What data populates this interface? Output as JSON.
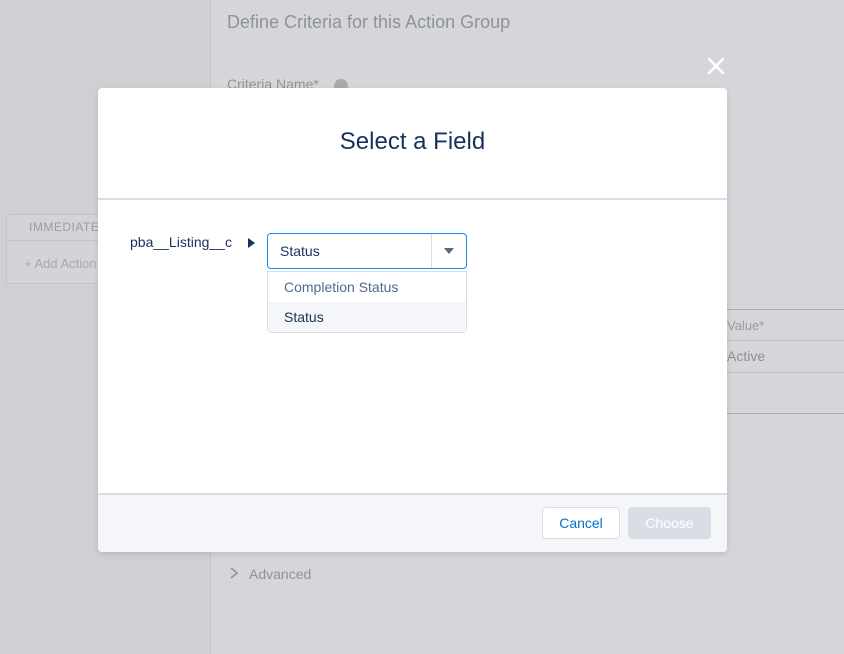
{
  "background": {
    "page_title": "Define Criteria for this Action Group",
    "criteria_name_label": "Criteria Name",
    "criteria_name_required_mark": "*",
    "immediate_label": "IMMEDIATE",
    "add_action_label": "+ Add Action",
    "value_header": "Value",
    "value_required_mark": "*",
    "value_cell": "Active",
    "advanced_label": "Advanced"
  },
  "modal": {
    "title": "Select a Field",
    "close_icon": "close-icon",
    "object_label": "pba__Listing__c",
    "field_select": {
      "value": "Status",
      "options": [
        "Completion Status",
        "Status"
      ],
      "selected": "Status"
    },
    "footer": {
      "cancel_label": "Cancel",
      "choose_label": "Choose"
    }
  },
  "colors": {
    "overlay": "#cfd0d3",
    "title_text": "#16325c",
    "focus_border": "#1589ee",
    "link_blue": "#0070d2",
    "disabled_button": "#d8dde6"
  }
}
